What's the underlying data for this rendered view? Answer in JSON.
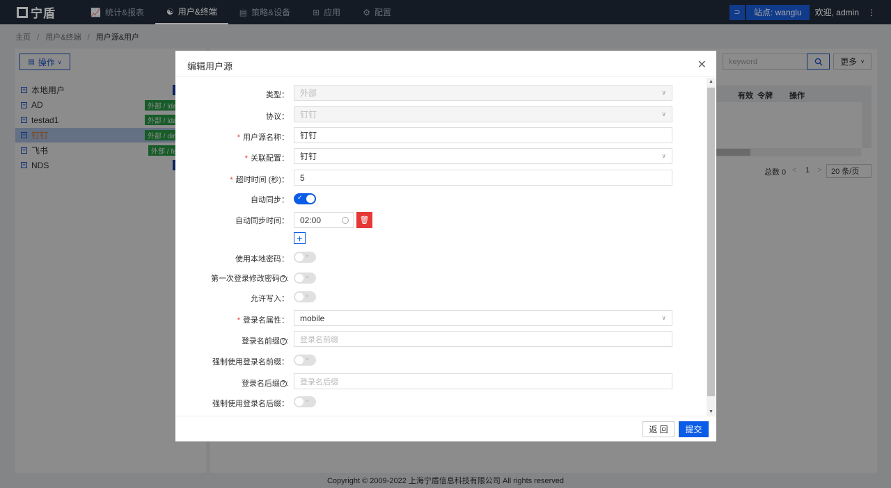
{
  "app": {
    "logo_text": "宁盾"
  },
  "nav": {
    "items": [
      {
        "label": "统计&报表",
        "icon": "chart-icon",
        "glyph": "📈"
      },
      {
        "label": "用户&终端",
        "icon": "user-icon",
        "glyph": "👤"
      },
      {
        "label": "策略&设备",
        "icon": "policy-icon",
        "glyph": "▤"
      },
      {
        "label": "应用",
        "icon": "grid-icon",
        "glyph": "⊞"
      },
      {
        "label": "配置",
        "icon": "gear-icon",
        "glyph": "⚙"
      }
    ],
    "site_label": "站点: wanglu",
    "welcome": "欢迎, admin"
  },
  "breadcrumb": {
    "home": "主页",
    "level1": "用户&终端",
    "current": "用户源&用户"
  },
  "left": {
    "operate_label": "操作",
    "tree": [
      {
        "name": "本地用户",
        "tag": ""
      },
      {
        "name": "AD",
        "tag": "外部 / ldap"
      },
      {
        "name": "testad1",
        "tag": "外部 / ldap"
      },
      {
        "name": "钉钉",
        "tag": "外部 / dingtalk"
      },
      {
        "name": "飞书",
        "tag": "外部 / feishu"
      },
      {
        "name": "NDS",
        "tag": ""
      }
    ]
  },
  "right": {
    "search_placeholder": "keyword",
    "more_label": "更多",
    "columns": [
      "有效",
      "令牌",
      "操作"
    ],
    "total": "总数 0",
    "page": "1",
    "page_size": "20 条/页"
  },
  "footer": "Copyright © 2009-2022 上海宁盾信息科技有限公司 All rights reserved",
  "modal": {
    "title": "编辑用户源",
    "type": {
      "label": "类型：",
      "value": "外部"
    },
    "protocol": {
      "label": "协议：",
      "value": "钉钉"
    },
    "source_name": {
      "label": "用户源名称：",
      "value": "钉钉"
    },
    "linked_config": {
      "label": "关联配置：",
      "value": "钉钉"
    },
    "timeout": {
      "label": "超时时间 (秒)：",
      "value": "5"
    },
    "auto_sync": {
      "label": "自动同步："
    },
    "auto_sync_time": {
      "label": "自动同步时间：",
      "value": "02:00"
    },
    "use_local_password": {
      "label": "使用本地密码："
    },
    "first_login_change": {
      "label": "第一次登录修改密码"
    },
    "allow_write": {
      "label": "允许写入："
    },
    "login_attr": {
      "label": "登录名属性：",
      "value": "mobile"
    },
    "login_prefix": {
      "label": "登录名前缀",
      "placeholder": "登录名前缀"
    },
    "force_prefix": {
      "label": "强制使用登录名前缀："
    },
    "login_suffix": {
      "label": "登录名后缀",
      "placeholder": "登录名后缀"
    },
    "force_suffix": {
      "label": "强制使用登录名后缀："
    },
    "back_label": "返 回",
    "submit_label": "提交"
  }
}
